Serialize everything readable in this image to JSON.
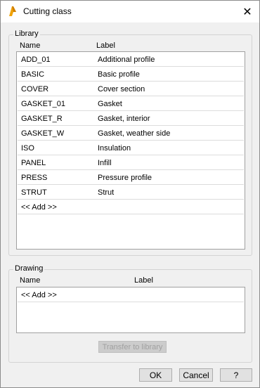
{
  "window": {
    "title": "Cutting class",
    "close_glyph": "✕",
    "icon": "app-icon",
    "accent_color": "#f0a30a"
  },
  "library": {
    "group_label": "Library",
    "columns": {
      "name": "Name",
      "label": "Label"
    },
    "rows": [
      {
        "name": "ADD_01",
        "label": "Additional profile"
      },
      {
        "name": "BASIC",
        "label": "Basic profile"
      },
      {
        "name": "COVER",
        "label": "Cover section"
      },
      {
        "name": "GASKET_01",
        "label": "Gasket"
      },
      {
        "name": "GASKET_R",
        "label": "Gasket, interior"
      },
      {
        "name": "GASKET_W",
        "label": "Gasket, weather side"
      },
      {
        "name": "ISO",
        "label": "Insulation"
      },
      {
        "name": "PANEL",
        "label": "Infill"
      },
      {
        "name": "PRESS",
        "label": "Pressure profile"
      },
      {
        "name": "STRUT",
        "label": "Strut"
      },
      {
        "name": "<< Add >>",
        "label": ""
      }
    ]
  },
  "drawing": {
    "group_label": "Drawing",
    "columns": {
      "name": "Name",
      "label": "Label"
    },
    "rows": [
      {
        "name": "<< Add >>",
        "label": ""
      }
    ],
    "transfer_button": "Transfer to library"
  },
  "buttons": {
    "ok": "OK",
    "cancel": "Cancel",
    "help": "?"
  }
}
